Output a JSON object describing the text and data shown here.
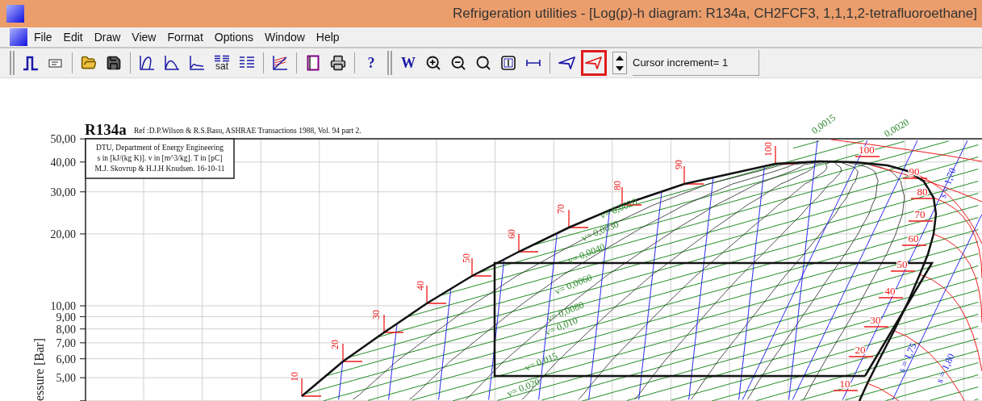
{
  "window": {
    "title": "Refrigeration utilities - [Log(p)-h diagram: R134a, CH2FCF3, 1,1,1,2-tetrafluoroethane]"
  },
  "menu": [
    "File",
    "Edit",
    "Draw",
    "View",
    "Format",
    "Options",
    "Window",
    "Help"
  ],
  "toolbar": [
    {
      "kind": "grip"
    },
    {
      "kind": "step"
    },
    {
      "kind": "card"
    },
    {
      "kind": "separator"
    },
    {
      "kind": "open"
    },
    {
      "kind": "save"
    },
    {
      "kind": "separator"
    },
    {
      "kind": "curve"
    },
    {
      "kind": "dome"
    },
    {
      "kind": "axes"
    },
    {
      "kind": "lines",
      "text": "sat"
    },
    {
      "kind": "table"
    },
    {
      "kind": "separator"
    },
    {
      "kind": "hatch"
    },
    {
      "kind": "separator"
    },
    {
      "kind": "page"
    },
    {
      "kind": "printer"
    },
    {
      "kind": "separator"
    },
    {
      "kind": "glyph",
      "text": "?"
    },
    {
      "kind": "grip"
    },
    {
      "kind": "glyph",
      "text": "W"
    },
    {
      "kind": "zoom-in"
    },
    {
      "kind": "zoom-out"
    },
    {
      "kind": "zoom"
    },
    {
      "kind": "fit"
    },
    {
      "kind": "width"
    },
    {
      "kind": "separator"
    },
    {
      "kind": "cursor",
      "selected": false
    },
    {
      "kind": "cursor",
      "selected": true
    }
  ],
  "cursor_increment": {
    "label": "Cursor increment= 1"
  },
  "diagram": {
    "title": "R134a",
    "reference": "Ref :D.P.Wilson & R.S.Basu, ASHRAE Transactions 1988, Vol. 94 part 2.",
    "info": [
      "DTU, Department of Energy Engineering",
      "s in [kJ/(kg K)]. v in [m^3/kg]. T in [pC]",
      "M.J. Skovrup & H.J.H Knudsen. 16-10-11"
    ],
    "y_axis_label": "essure [Bar]",
    "y_ticks": [
      "50,00",
      "40,00",
      "30,00",
      "20,00",
      "10,00",
      "9,00",
      "8,00",
      "7,00",
      "6,00",
      "5,00"
    ],
    "liquid_temperatures": [
      "10",
      "20",
      "30",
      "40",
      "50",
      "60",
      "70",
      "80",
      "90",
      "100"
    ],
    "vapor_temperatures": [
      "100",
      "90",
      "80",
      "70",
      "60",
      "50",
      "40",
      "30",
      "20",
      "10"
    ],
    "volume_labels": [
      "0,0015",
      "0,0020",
      "v= 0,0020",
      "v= 0,0030",
      "v= 0,0040",
      "v= 0,0060",
      "v= 0,0080",
      "v= 0,010",
      "v= 0,015",
      "v= 0,020"
    ],
    "entropy_labels": [
      "s = 1,70",
      "s = 1,75",
      "s = 1,80"
    ]
  }
}
